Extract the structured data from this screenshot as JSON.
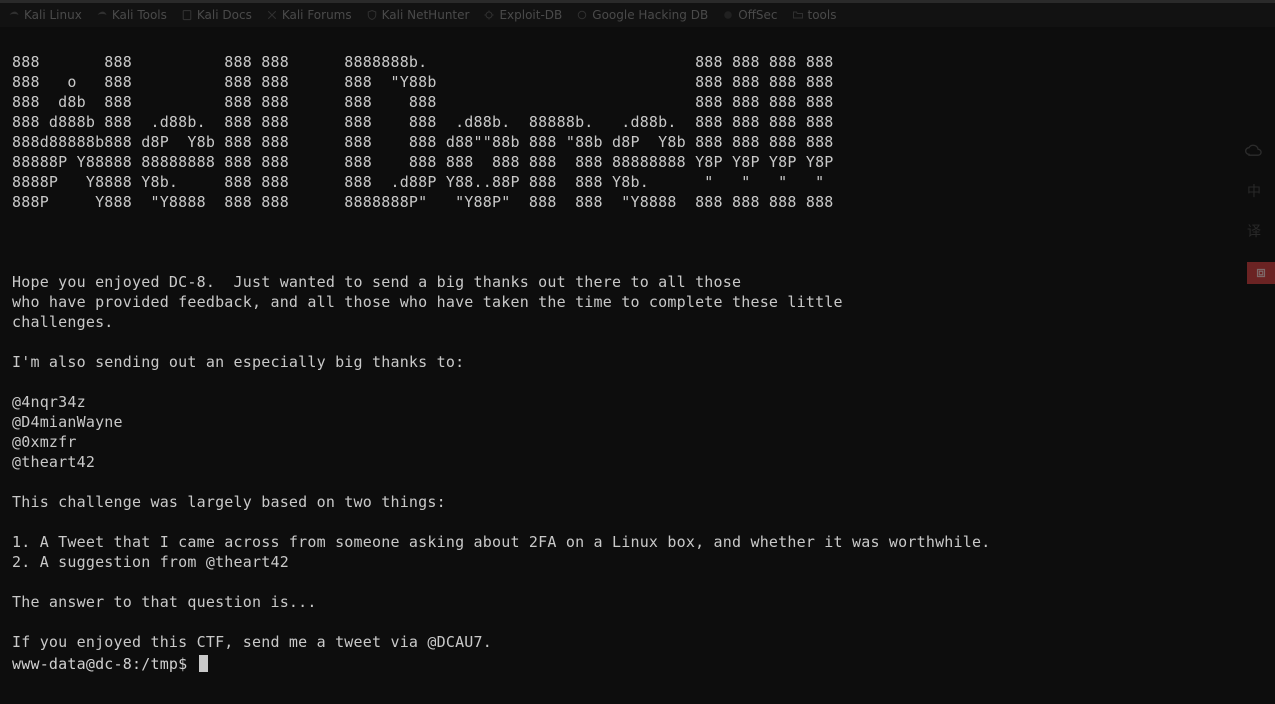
{
  "bookmarks": [
    {
      "label": "Kali Linux",
      "icon": "dragon"
    },
    {
      "label": "Kali Tools",
      "icon": "dragon"
    },
    {
      "label": "Kali Docs",
      "icon": "book"
    },
    {
      "label": "Kali Forums",
      "icon": "x"
    },
    {
      "label": "Kali NetHunter",
      "icon": "shield"
    },
    {
      "label": "Exploit-DB",
      "icon": "bug"
    },
    {
      "label": "Google Hacking DB",
      "icon": "google"
    },
    {
      "label": "OffSec",
      "icon": "offsec"
    },
    {
      "label": "tools",
      "icon": "folder"
    }
  ],
  "ascii_art": "888       888          888 888      8888888b.                             888 888 888 888\n888   o   888          888 888      888  \"Y88b                            888 888 888 888\n888  d8b  888          888 888      888    888                            888 888 888 888\n888 d888b 888  .d88b.  888 888      888    888  .d88b.  88888b.   .d88b.  888 888 888 888\n888d88888b888 d8P  Y8b 888 888      888    888 d88\"\"88b 888 \"88b d8P  Y8b 888 888 888 888\n88888P Y88888 88888888 888 888      888    888 888  888 888  888 88888888 Y8P Y8P Y8P Y8P\n8888P   Y8888 Y8b.     888 888      888  .d88P Y88..88P 888  888 Y8b.      \"   \"   \"   \"\n888P     Y888  \"Y8888  888 888      8888888P\"   \"Y88P\"  888  888  \"Y8888  888 888 888 888",
  "body_text": "\n\n\nHope you enjoyed DC-8.  Just wanted to send a big thanks out there to all those\nwho have provided feedback, and all those who have taken the time to complete these little\nchallenges.\n\nI'm also sending out an especially big thanks to:\n\n@4nqr34z\n@D4mianWayne\n@0xmzfr\n@theart42\n\nThis challenge was largely based on two things:\n\n1. A Tweet that I came across from someone asking about 2FA on a Linux box, and whether it was worthwhile.\n2. A suggestion from @theart42\n\nThe answer to that question is...\n\nIf you enjoyed this CTF, send me a tweet via @DCAU7.\n",
  "prompt": "www-data@dc-8:/tmp$ ",
  "side_icons": {
    "cloud": "cloud-icon",
    "lang": "中",
    "list": "译"
  }
}
